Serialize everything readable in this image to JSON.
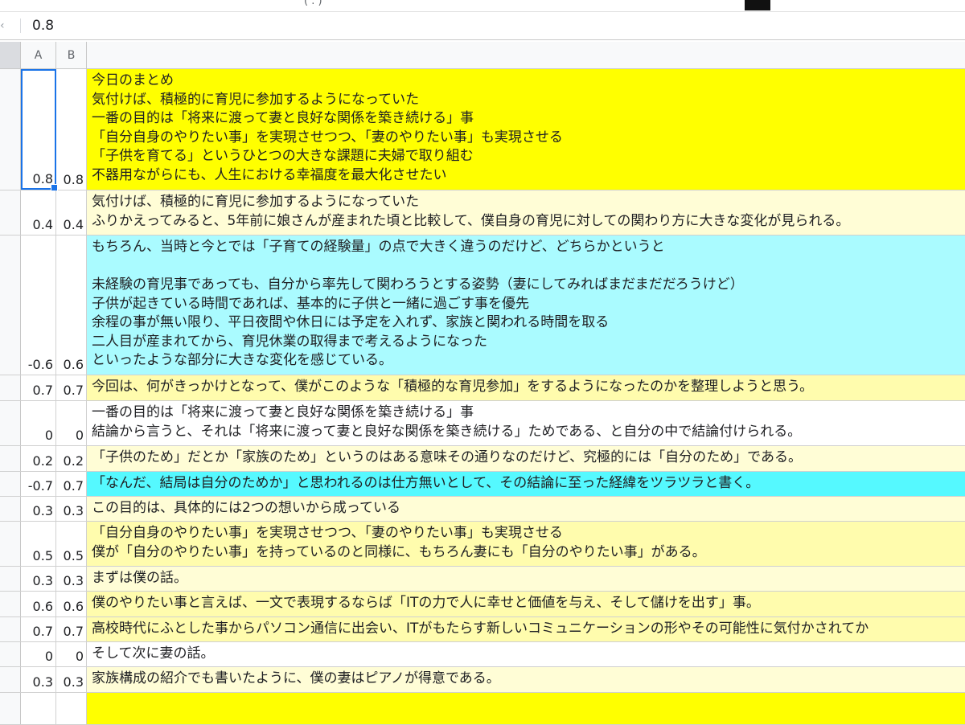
{
  "window": {
    "title_fragment": "( . )"
  },
  "formula_bar": {
    "value": "0.8"
  },
  "columns": {
    "a": "A",
    "b": "B",
    "c": ""
  },
  "colors": {
    "yellow": "#ffff00",
    "light_yellow": "#fffdd6",
    "pale_yellow": "#fffcad",
    "light_cyan": "#aafbff",
    "cyan": "#55f9ff",
    "white": "#ffffff"
  },
  "rows": [
    {
      "a": "0.8",
      "b": "0.8",
      "bg": "yellow",
      "text": "今日のまとめ\n気付けば、積極的に育児に参加するようになっていた\n一番の目的は「将来に渡って妻と良好な関係を築き続ける」事\n「自分自身のやりたい事」を実現させつつ、「妻のやりたい事」も実現させる\n「子供を育てる」というひとつの大きな課題に夫婦で取り組む\n不器用ながらにも、人生における幸福度を最大化させたい",
      "selected": true
    },
    {
      "a": "0.4",
      "b": "0.4",
      "bg": "light_yellow",
      "text": "気付けば、積極的に育児に参加するようになっていた\nふりかえってみると、5年前に娘さんが産まれた頃と比較して、僕自身の育児に対しての関わり方に大きな変化が見られる。"
    },
    {
      "a": "-0.6",
      "b": "0.6",
      "bg": "light_cyan",
      "text": "もちろん、当時と今とでは「子育ての経験量」の点で大きく違うのだけど、どちらかというと\n\n未経験の育児事であっても、自分から率先して関わろうとする姿勢（妻にしてみればまだまだだろうけど）\n子供が起きている時間であれば、基本的に子供と一緒に過ごす事を優先\n余程の事が無い限り、平日夜間や休日には予定を入れず、家族と関われる時間を取る\n二人目が産まれてから、育児休業の取得まで考えるようになった\nといったような部分に大きな変化を感じている。"
    },
    {
      "a": "0.7",
      "b": "0.7",
      "bg": "pale_yellow",
      "text": "今回は、何がきっかけとなって、僕がこのような「積極的な育児参加」をするようになったのかを整理しようと思う。"
    },
    {
      "a": "0",
      "b": "0",
      "bg": "white",
      "text": "一番の目的は「将来に渡って妻と良好な関係を築き続ける」事\n結論から言うと、それは「将来に渡って妻と良好な関係を築き続ける」ためである、と自分の中で結論付けられる。"
    },
    {
      "a": "0.2",
      "b": "0.2",
      "bg": "light_yellow",
      "text": "「子供のため」だとか「家族のため」というのはある意味その通りなのだけど、究極的には「自分のため」である。"
    },
    {
      "a": "-0.7",
      "b": "0.7",
      "bg": "cyan",
      "text": "「なんだ、結局は自分のためか」と思われるのは仕方無いとして、その結論に至った経緯をツラツラと書く。"
    },
    {
      "a": "0.3",
      "b": "0.3",
      "bg": "light_yellow",
      "text": "この目的は、具体的には2つの想いから成っている"
    },
    {
      "a": "0.5",
      "b": "0.5",
      "bg": "pale_yellow",
      "text": "「自分自身のやりたい事」を実現させつつ、「妻のやりたい事」も実現させる\n僕が「自分のやりたい事」を持っているのと同様に、もちろん妻にも「自分のやりたい事」がある。"
    },
    {
      "a": "0.3",
      "b": "0.3",
      "bg": "light_yellow",
      "text": "まずは僕の話。"
    },
    {
      "a": "0.6",
      "b": "0.6",
      "bg": "pale_yellow",
      "text": "僕のやりたい事と言えば、一文で表現するならば「ITの力で人に幸せと価値を与え、そして儲けを出す」事。"
    },
    {
      "a": "0.7",
      "b": "0.7",
      "bg": "pale_yellow",
      "text": "高校時代にふとした事からパソコン通信に出会い、ITがもたらす新しいコミュニケーションの形やその可能性に気付かされてか"
    },
    {
      "a": "0",
      "b": "0",
      "bg": "white",
      "text": "そして次に妻の話。"
    },
    {
      "a": "0.3",
      "b": "0.3",
      "bg": "light_yellow",
      "text": "家族構成の紹介でも書いたように、僕の妻はピアノが得意である。"
    },
    {
      "a": "",
      "b": "",
      "bg": "yellow",
      "text": ""
    }
  ]
}
